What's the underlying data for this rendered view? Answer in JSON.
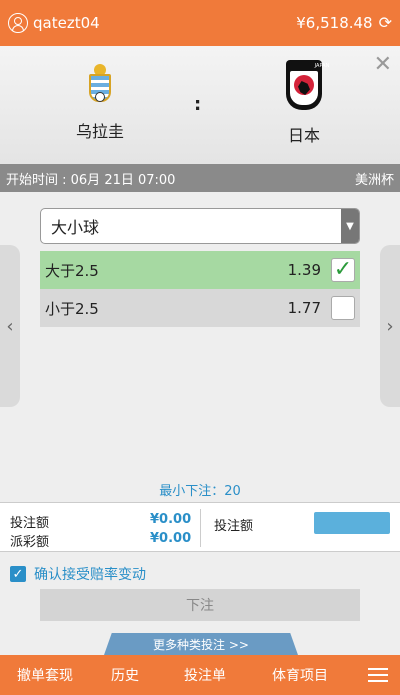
{
  "header": {
    "username": "qatezt04",
    "balance": "¥6,518.48"
  },
  "match": {
    "home_team": "乌拉圭",
    "away_team": "日本",
    "separator": ":",
    "away_logo_text": "JAPAN"
  },
  "info": {
    "start_time": "开始时间 : 06月 21日 07:00",
    "league": "美洲杯"
  },
  "market": {
    "selected": "大小球"
  },
  "options": [
    {
      "label": "大于2.5",
      "odds": "1.39",
      "checked": true
    },
    {
      "label": "小于2.5",
      "odds": "1.77",
      "checked": false
    }
  ],
  "stake": {
    "min_stake": "最小下注：20",
    "bet_amount_label": "投注额",
    "bet_amount_value": "¥0.00",
    "payout_label": "派彩额",
    "payout_value": "¥0.00",
    "input_label": "投注额"
  },
  "confirm_label": "确认接受赔率变动",
  "submit_label": "下注",
  "more_bets_label": "更多种类投注 >>",
  "nav": {
    "cashout": "撤单套现",
    "history": "历史",
    "betslip": "投注单",
    "sports": "体育项目"
  },
  "colors": {
    "brand": "#f07a3a",
    "accent": "#2a8fc8",
    "selected_option": "#a6d9a2"
  }
}
